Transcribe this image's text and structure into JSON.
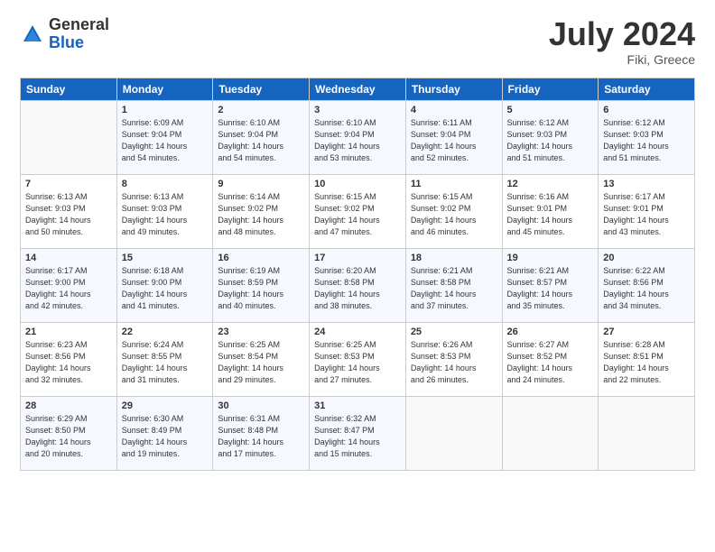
{
  "logo": {
    "general": "General",
    "blue": "Blue"
  },
  "title": "July 2024",
  "location": "Fiki, Greece",
  "days_of_week": [
    "Sunday",
    "Monday",
    "Tuesday",
    "Wednesday",
    "Thursday",
    "Friday",
    "Saturday"
  ],
  "weeks": [
    [
      {
        "day": "",
        "info": ""
      },
      {
        "day": "1",
        "info": "Sunrise: 6:09 AM\nSunset: 9:04 PM\nDaylight: 14 hours\nand 54 minutes."
      },
      {
        "day": "2",
        "info": "Sunrise: 6:10 AM\nSunset: 9:04 PM\nDaylight: 14 hours\nand 54 minutes."
      },
      {
        "day": "3",
        "info": "Sunrise: 6:10 AM\nSunset: 9:04 PM\nDaylight: 14 hours\nand 53 minutes."
      },
      {
        "day": "4",
        "info": "Sunrise: 6:11 AM\nSunset: 9:04 PM\nDaylight: 14 hours\nand 52 minutes."
      },
      {
        "day": "5",
        "info": "Sunrise: 6:12 AM\nSunset: 9:03 PM\nDaylight: 14 hours\nand 51 minutes."
      },
      {
        "day": "6",
        "info": "Sunrise: 6:12 AM\nSunset: 9:03 PM\nDaylight: 14 hours\nand 51 minutes."
      }
    ],
    [
      {
        "day": "7",
        "info": "Sunrise: 6:13 AM\nSunset: 9:03 PM\nDaylight: 14 hours\nand 50 minutes."
      },
      {
        "day": "8",
        "info": "Sunrise: 6:13 AM\nSunset: 9:03 PM\nDaylight: 14 hours\nand 49 minutes."
      },
      {
        "day": "9",
        "info": "Sunrise: 6:14 AM\nSunset: 9:02 PM\nDaylight: 14 hours\nand 48 minutes."
      },
      {
        "day": "10",
        "info": "Sunrise: 6:15 AM\nSunset: 9:02 PM\nDaylight: 14 hours\nand 47 minutes."
      },
      {
        "day": "11",
        "info": "Sunrise: 6:15 AM\nSunset: 9:02 PM\nDaylight: 14 hours\nand 46 minutes."
      },
      {
        "day": "12",
        "info": "Sunrise: 6:16 AM\nSunset: 9:01 PM\nDaylight: 14 hours\nand 45 minutes."
      },
      {
        "day": "13",
        "info": "Sunrise: 6:17 AM\nSunset: 9:01 PM\nDaylight: 14 hours\nand 43 minutes."
      }
    ],
    [
      {
        "day": "14",
        "info": "Sunrise: 6:17 AM\nSunset: 9:00 PM\nDaylight: 14 hours\nand 42 minutes."
      },
      {
        "day": "15",
        "info": "Sunrise: 6:18 AM\nSunset: 9:00 PM\nDaylight: 14 hours\nand 41 minutes."
      },
      {
        "day": "16",
        "info": "Sunrise: 6:19 AM\nSunset: 8:59 PM\nDaylight: 14 hours\nand 40 minutes."
      },
      {
        "day": "17",
        "info": "Sunrise: 6:20 AM\nSunset: 8:58 PM\nDaylight: 14 hours\nand 38 minutes."
      },
      {
        "day": "18",
        "info": "Sunrise: 6:21 AM\nSunset: 8:58 PM\nDaylight: 14 hours\nand 37 minutes."
      },
      {
        "day": "19",
        "info": "Sunrise: 6:21 AM\nSunset: 8:57 PM\nDaylight: 14 hours\nand 35 minutes."
      },
      {
        "day": "20",
        "info": "Sunrise: 6:22 AM\nSunset: 8:56 PM\nDaylight: 14 hours\nand 34 minutes."
      }
    ],
    [
      {
        "day": "21",
        "info": "Sunrise: 6:23 AM\nSunset: 8:56 PM\nDaylight: 14 hours\nand 32 minutes."
      },
      {
        "day": "22",
        "info": "Sunrise: 6:24 AM\nSunset: 8:55 PM\nDaylight: 14 hours\nand 31 minutes."
      },
      {
        "day": "23",
        "info": "Sunrise: 6:25 AM\nSunset: 8:54 PM\nDaylight: 14 hours\nand 29 minutes."
      },
      {
        "day": "24",
        "info": "Sunrise: 6:25 AM\nSunset: 8:53 PM\nDaylight: 14 hours\nand 27 minutes."
      },
      {
        "day": "25",
        "info": "Sunrise: 6:26 AM\nSunset: 8:53 PM\nDaylight: 14 hours\nand 26 minutes."
      },
      {
        "day": "26",
        "info": "Sunrise: 6:27 AM\nSunset: 8:52 PM\nDaylight: 14 hours\nand 24 minutes."
      },
      {
        "day": "27",
        "info": "Sunrise: 6:28 AM\nSunset: 8:51 PM\nDaylight: 14 hours\nand 22 minutes."
      }
    ],
    [
      {
        "day": "28",
        "info": "Sunrise: 6:29 AM\nSunset: 8:50 PM\nDaylight: 14 hours\nand 20 minutes."
      },
      {
        "day": "29",
        "info": "Sunrise: 6:30 AM\nSunset: 8:49 PM\nDaylight: 14 hours\nand 19 minutes."
      },
      {
        "day": "30",
        "info": "Sunrise: 6:31 AM\nSunset: 8:48 PM\nDaylight: 14 hours\nand 17 minutes."
      },
      {
        "day": "31",
        "info": "Sunrise: 6:32 AM\nSunset: 8:47 PM\nDaylight: 14 hours\nand 15 minutes."
      },
      {
        "day": "",
        "info": ""
      },
      {
        "day": "",
        "info": ""
      },
      {
        "day": "",
        "info": ""
      }
    ]
  ]
}
